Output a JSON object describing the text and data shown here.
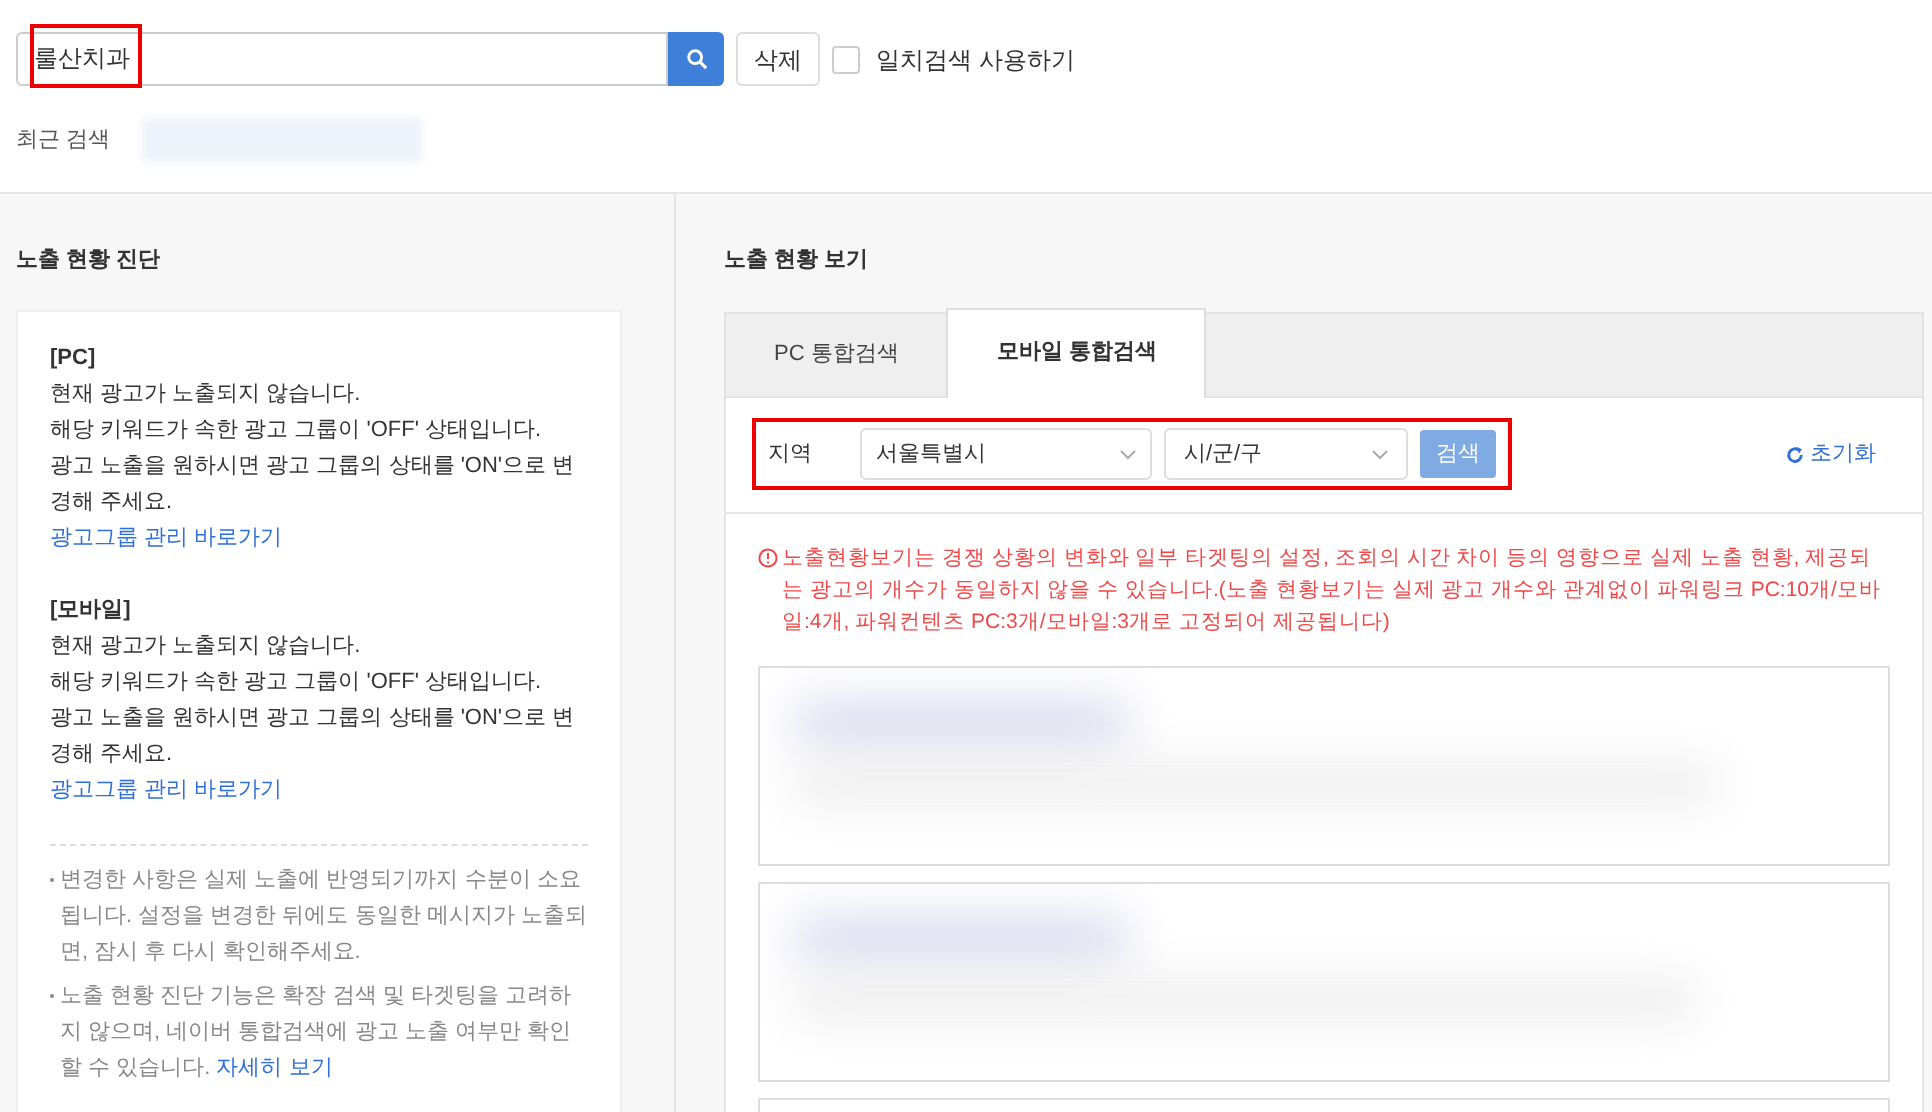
{
  "search": {
    "value": "룰산치과",
    "delete_button": "삭제",
    "exact_match": {
      "label": "일치검색 사용하기",
      "checked": false
    },
    "recent_label": "최근 검색"
  },
  "diagnosis": {
    "title": "노출 현황 진단",
    "sections": [
      {
        "heading": "[PC]",
        "lines": [
          "현재 광고가 노출되지 않습니다.",
          "해당 키워드가 속한 광고 그룹이 'OFF' 상태입니다.",
          "광고 노출을 원하시면 광고 그룹의 상태를 'ON'으로 변경해 주세요."
        ],
        "link": "광고그룹 관리 바로가기"
      },
      {
        "heading": "[모바일]",
        "lines": [
          "현재 광고가 노출되지 않습니다.",
          "해당 키워드가 속한 광고 그룹이 'OFF' 상태입니다.",
          "광고 노출을 원하시면 광고 그룹의 상태를 'ON'으로 변경해 주세요."
        ],
        "link": "광고그룹 관리 바로가기"
      }
    ],
    "notes": [
      {
        "text": "변경한 사항은 실제 노출에 반영되기까지 수분이 소요됩니다. 설정을 변경한 뒤에도 동일한 메시지가 노출되면, 잠시 후 다시 확인해주세요."
      },
      {
        "text": "노출 현황 진단 기능은 확장 검색 및 타겟팅을 고려하지 않으며, 네이버 통합검색에 광고 노출 여부만 확인할 수 있습니다.",
        "link": "자세히 보기"
      }
    ]
  },
  "preview": {
    "title": "노출 현황 보기",
    "tabs": [
      {
        "label": "PC 통합검색",
        "selected": false
      },
      {
        "label": "모바일 통합검색",
        "selected": true
      }
    ],
    "region_label": "지역",
    "region": "서울특별시",
    "district": "시/군/구",
    "search_button": "검색",
    "reset": "초기화",
    "warning": "노출현황보기는 경쟁 상황의 변화와 일부 타겟팅의 설정, 조회의 시간 차이 등의 영향으로 실제 노출 현황, 제공되는 광고의 개수가 동일하지 않을 수 있습니다.(노출 현황보기는 실제 광고 개수와 관계없이 파워링크 PC:10개/모바일:4개, 파워컨텐츠 PC:3개/모바일:3개로 고정되어 제공됩니다)"
  }
}
